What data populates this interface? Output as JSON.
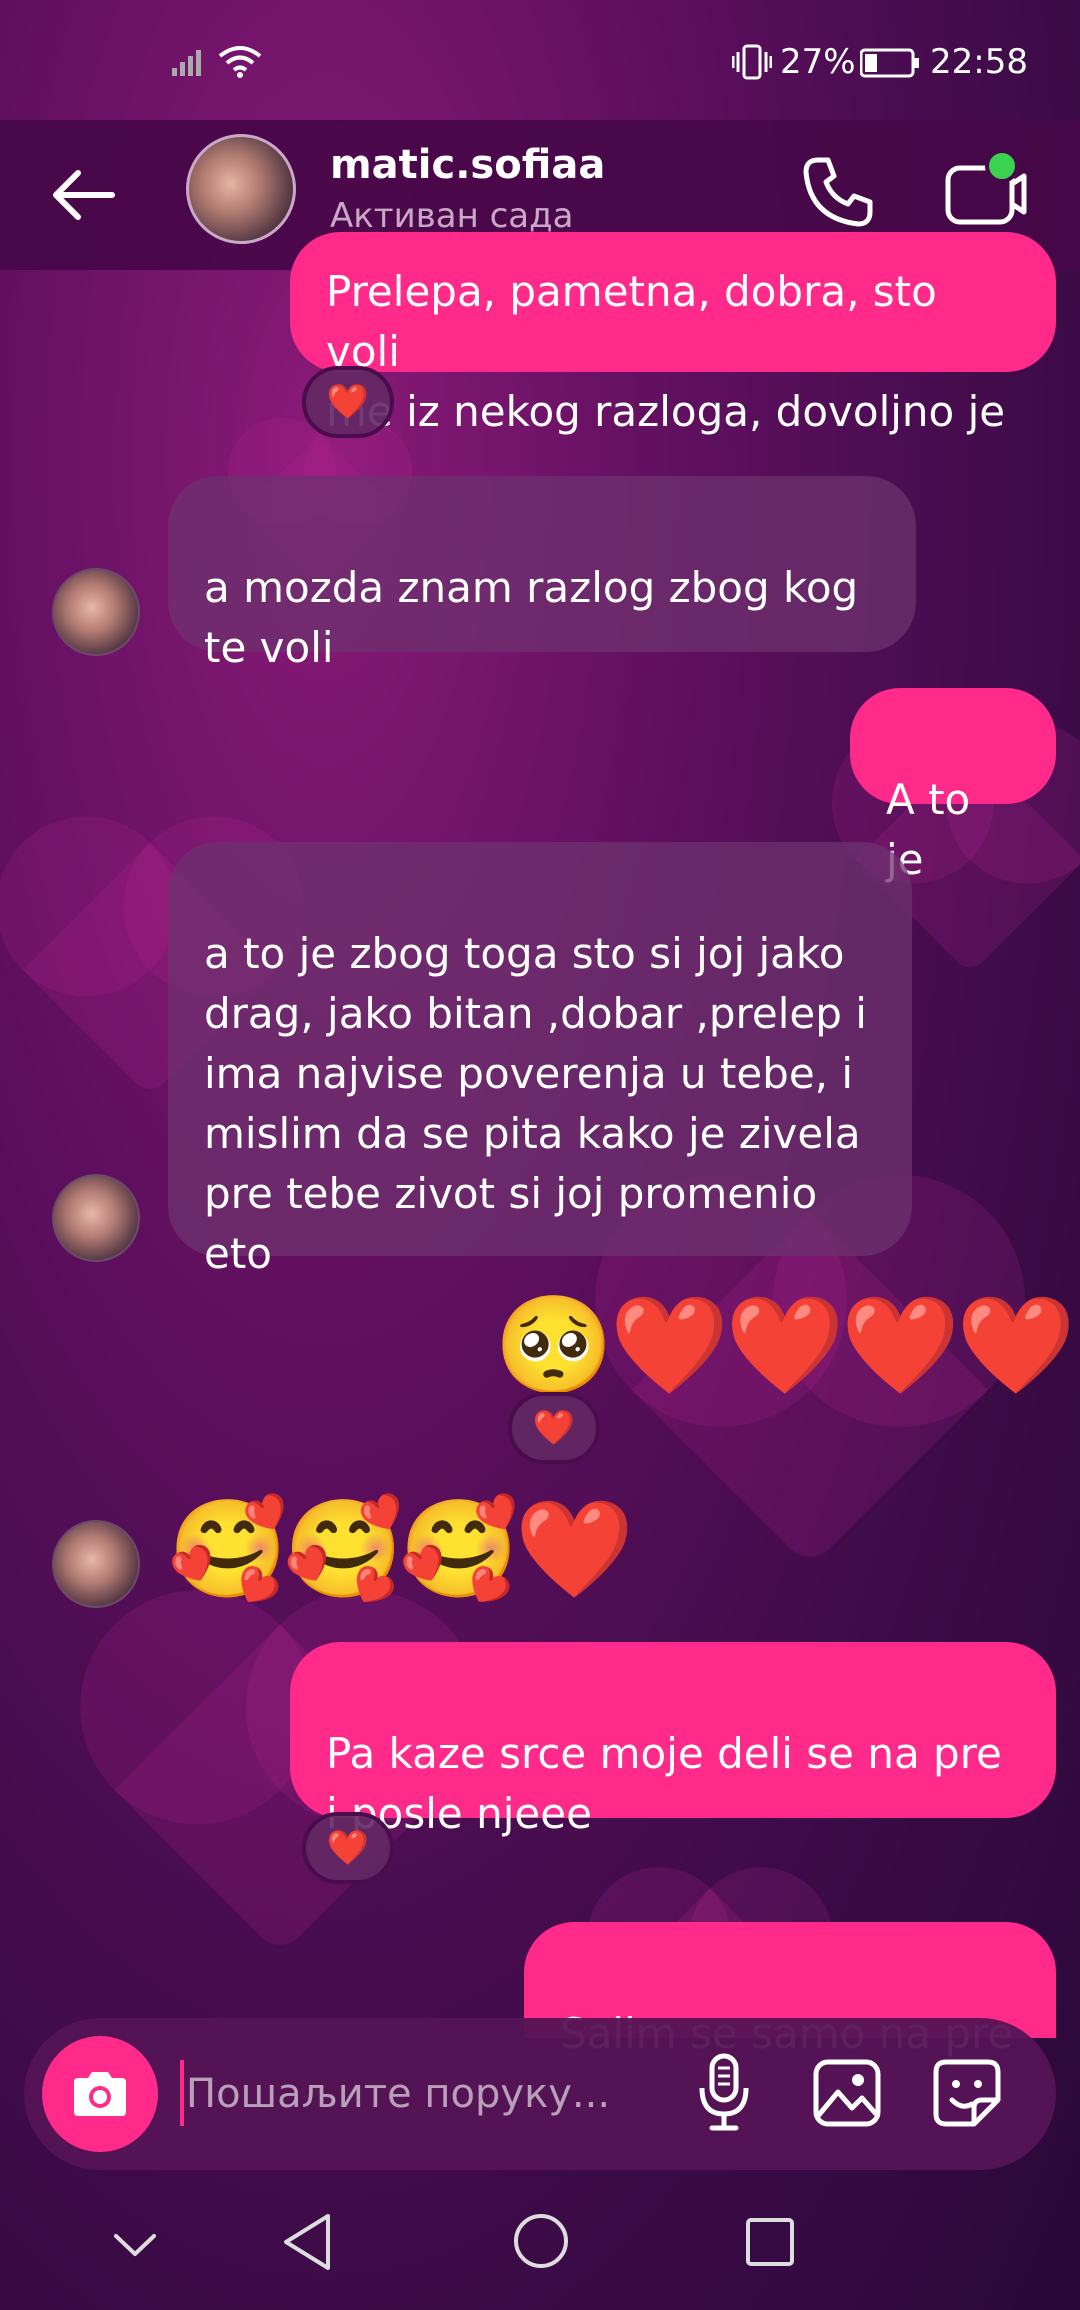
{
  "status_bar": {
    "battery_percent": "27%",
    "time": "22:58"
  },
  "header": {
    "contact_name": "matic.sofiaa",
    "contact_status": "Активан сада"
  },
  "messages": [
    {
      "type": "sent",
      "text": "Prelepa, pametna, dobra, sto voli\nme iz nekog razloga, dovoljno je",
      "reaction": "❤️"
    },
    {
      "type": "received",
      "text": "a mozda znam razlog zbog kog\nte voli"
    },
    {
      "type": "sent",
      "text": "A to je"
    },
    {
      "type": "received",
      "text": "a to je zbog toga sto si joj jako\ndrag, jako bitan ,dobar ,prelep i\nima najvise poverenja u tebe, i\nmislim da se pita kako je zivela\npre tebe zivot si joj promenio\neto"
    },
    {
      "type": "sent",
      "text": "🥺❤️❤️❤️❤️",
      "reaction": "❤️"
    },
    {
      "type": "received",
      "text": "🥰🥰🥰❤️"
    },
    {
      "type": "sent",
      "text": "Pa kaze srce moje deli se na pre\ni posle njeee",
      "reaction": "❤️"
    },
    {
      "type": "sent",
      "text": "Salim se samo na pre"
    }
  ],
  "composer": {
    "placeholder": "Пошаљите поруку..."
  },
  "colors": {
    "sent_bubble": "#ff2a8a",
    "received_bubble": "#6e326e",
    "background": "#5e0f5e"
  },
  "icons": [
    "back-arrow-icon",
    "phone-icon",
    "video-icon",
    "camera-icon",
    "microphone-icon",
    "gallery-icon",
    "sticker-icon",
    "nav-back-icon",
    "nav-home-icon",
    "nav-recents-icon",
    "nav-hide-icon"
  ]
}
